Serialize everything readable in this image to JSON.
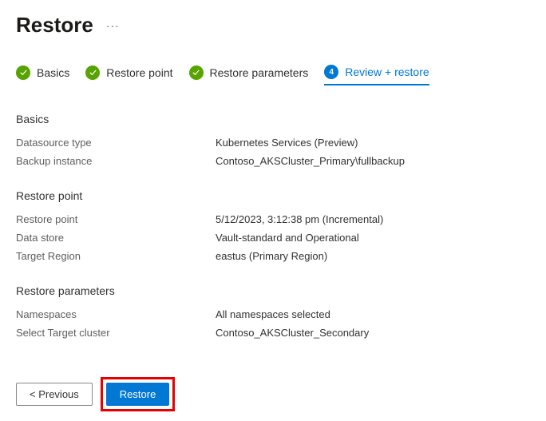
{
  "header": {
    "title": "Restore"
  },
  "steps": {
    "basics": "Basics",
    "restore_point": "Restore point",
    "restore_params": "Restore parameters",
    "review": "Review + restore",
    "current_number": "4"
  },
  "sections": {
    "basics": {
      "title": "Basics",
      "datasource_type_label": "Datasource type",
      "datasource_type_value": "Kubernetes Services (Preview)",
      "backup_instance_label": "Backup instance",
      "backup_instance_value": "Contoso_AKSCluster_Primary\\fullbackup"
    },
    "restore_point": {
      "title": "Restore point",
      "restore_point_label": "Restore point",
      "restore_point_value": "5/12/2023, 3:12:38 pm (Incremental)",
      "data_store_label": "Data store",
      "data_store_value": "Vault-standard and Operational",
      "target_region_label": "Target Region",
      "target_region_value": "eastus (Primary Region)"
    },
    "restore_params": {
      "title": "Restore parameters",
      "namespaces_label": "Namespaces",
      "namespaces_value": "All namespaces selected",
      "target_cluster_label": "Select Target cluster",
      "target_cluster_value": "Contoso_AKSCluster_Secondary"
    }
  },
  "footer": {
    "previous": "< Previous",
    "restore": "Restore"
  }
}
